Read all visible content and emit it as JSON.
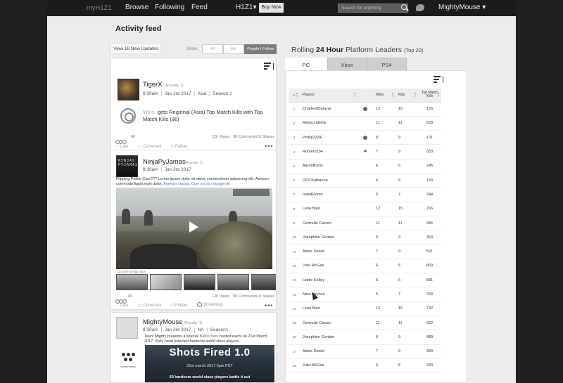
{
  "topbar": {
    "logo": "myH1Z1",
    "nav": [
      "Browse",
      "Following",
      "Feed"
    ],
    "game_selector": "H1Z1▾",
    "buy_now": "Buy Now",
    "search_placeholder": "Search for anything",
    "user": "MightyMouse ▾"
  },
  "page_title": "Activity feed",
  "feed": {
    "new_updates": "View 16 New Updates",
    "show_label": "Show:",
    "filters": [
      "All",
      "Me",
      "People I Follow"
    ],
    "active_filter": "People I Follow",
    "posts": [
      {
        "username": "TigerX",
        "royalty": "(Royalty 1)",
        "meta": [
          "8:30am",
          "Jan 3rd 2017",
          "Asia",
          "Season 1"
        ],
        "activity_prefix": "Wins,",
        "activity_text": "gets Regional (Asia) Top Match Kills with Top Match Kills (36)",
        "react_count": "66",
        "views": "12k Views",
        "comments": "90 Comments",
        "shares": "19 Shares",
        "actions": [
          "Like",
          "Comment",
          "Follow"
        ]
      },
      {
        "username": "NinjaPyJamas",
        "royalty": "(Royalty 1)",
        "avatar_text": "NINJAS PYJAMAS",
        "meta": [
          "8:30am",
          "Jan 3rd 2017"
        ],
        "text": "Flipping Police Cars??? Lorem ipsum dolor sit amet, consectetuer adipiscing elit. Aenean commodo ligula eget dolor.",
        "text_link": "Aenean massa. Cum sociis natoque",
        "text_link_end": "et",
        "more_clips": "13 more similar clips",
        "react_count": "66",
        "views": "120 Views",
        "comments": "90 Comments",
        "shares": "19 Shares",
        "actions": [
          "Like",
          "Comment",
          "Follow",
          "Streaming"
        ]
      },
      {
        "username": "MightyMouse",
        "royalty": "(Royalty 1)",
        "meta": [
          "8:30am",
          "Jan 3rd 2017",
          "NA",
          "Season1"
        ],
        "text": "Team Mighty presents a special",
        "text_link": "Battle Bets",
        "text_end": "hosted event on 21st March 2017. Sixty hand selected hardcore world class players.",
        "hosted_label": "hosted events",
        "poster_title": "Shots Fired 1.0",
        "poster_date": "21st march 2017 5pm PST",
        "poster_tagline": "60 hardcore world class players battle it out"
      }
    ]
  },
  "leaderboard": {
    "title_pre": "Rolling",
    "title_bold": "24 Hour",
    "title_post": "Platform Leaders",
    "title_small": "(Top 20)",
    "tabs": [
      "PC",
      "Xbox",
      "PS4"
    ],
    "active_tab": "PC",
    "columns": [
      "#",
      "Players",
      "Wins",
      "Kills",
      "Top Match Kills"
    ],
    "rows": [
      {
        "rank": "1",
        "player": "Charles0Salazar",
        "icon": "circle",
        "wins": "12",
        "kills": "15",
        "top": "155"
      },
      {
        "rank": "2",
        "player": "RebeccaKelly",
        "icon": "",
        "wins": "11",
        "kills": "11",
        "top": "633"
      },
      {
        "rank": "3",
        "player": "Phillip2334",
        "icon": "circle",
        "wins": "9",
        "kills": "9",
        "top": "101"
      },
      {
        "rank": "4",
        "player": "Romero234",
        "icon": "star",
        "wins": "7",
        "kills": "9",
        "top": "833"
      },
      {
        "rank": "5",
        "player": "AaronBurns",
        "icon": "",
        "wins": "6",
        "kills": "6",
        "top": "245"
      },
      {
        "rank": "6",
        "player": "DOCKatharine",
        "icon": "",
        "wins": "6",
        "kills": "6",
        "top": "193"
      },
      {
        "rank": "7",
        "player": "Ivan4Flores",
        "icon": "",
        "wins": "5",
        "kills": "7",
        "top": "244"
      },
      {
        "rank": "8",
        "player": "Lena Blair",
        "icon": "",
        "wins": "12",
        "kills": "15",
        "top": "766"
      },
      {
        "rank": "9",
        "player": "Gertrude Carson",
        "icon": "",
        "wins": "11",
        "kills": "11",
        "top": "386"
      },
      {
        "rank": "10",
        "player": "Josephine Gordon",
        "icon": "",
        "wins": "9",
        "kills": "9",
        "top": "363"
      },
      {
        "rank": "11",
        "player": "Adele Daniel",
        "icon": "",
        "wins": "7",
        "kills": "9",
        "top": "521"
      },
      {
        "rank": "12",
        "player": "Julia McGee",
        "icon": "",
        "wins": "6",
        "kills": "6",
        "top": "800"
      },
      {
        "rank": "12",
        "player": "Hattie Kelley",
        "icon": "",
        "wins": "6",
        "kills": "6",
        "top": "881"
      },
      {
        "rank": "13",
        "player": "Nina Haynes",
        "icon": "",
        "wins": "5",
        "kills": "7",
        "top": "753"
      },
      {
        "rank": "14",
        "player": "Lena Blair",
        "icon": "",
        "wins": "12",
        "kills": "15",
        "top": "732"
      },
      {
        "rank": "15",
        "player": "Gertrude Carson",
        "icon": "",
        "wins": "11",
        "kills": "11",
        "top": "662"
      },
      {
        "rank": "16",
        "player": "Josephine Gordon",
        "icon": "",
        "wins": "9",
        "kills": "9",
        "top": "489"
      },
      {
        "rank": "17",
        "player": "Adele Daniel",
        "icon": "",
        "wins": "7",
        "kills": "9",
        "top": "489"
      },
      {
        "rank": "18",
        "player": "Julia McGee",
        "icon": "",
        "wins": "6",
        "kills": "6",
        "top": "230"
      }
    ]
  },
  "colors": {
    "topbar": "#1b1b1b",
    "page_bg": "#ececec",
    "active_filter": "#7c7c7c",
    "tab_inactive": "#cfcfcf"
  }
}
